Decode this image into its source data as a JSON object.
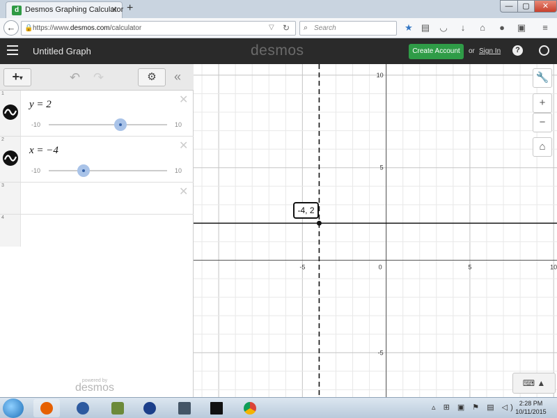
{
  "browser": {
    "tab_title": "Desmos Graphing Calculator",
    "tab_close": "✕",
    "new_tab": "+",
    "url_prefix": "https://www.",
    "url_domain": "desmos.com",
    "url_path": "/calculator",
    "search_placeholder": "Search",
    "window_buttons": {
      "minimize": "—",
      "maximize": "▢",
      "close": "✕"
    }
  },
  "app": {
    "graph_title": "Untitled Graph",
    "logo": "desmos",
    "create_account": "Create Account",
    "or": "or",
    "sign_in": "Sign In",
    "help": "?"
  },
  "expressions": [
    {
      "index": "1",
      "latex": "y = 2",
      "slider_min": "-10",
      "slider_max": "10",
      "slider_value": 2
    },
    {
      "index": "2",
      "latex": "x = −4",
      "slider_min": "-10",
      "slider_max": "10",
      "slider_value": -4
    },
    {
      "index": "3"
    },
    {
      "index": "4"
    }
  ],
  "powered": {
    "by": "powered by",
    "logo": "desmos"
  },
  "graph": {
    "x_range": [
      -11.5,
      10.2
    ],
    "y_range": [
      -7.4,
      10.6
    ],
    "x_tick_labels": [
      "-5",
      "0",
      "5",
      "10"
    ],
    "y_tick_labels": [
      "10",
      "5",
      "-5"
    ],
    "lines": [
      {
        "kind": "horizontal",
        "value": 2,
        "style": "solid",
        "color": "#111111"
      },
      {
        "kind": "vertical",
        "value": -4,
        "style": "dashed",
        "color": "#111111"
      }
    ],
    "point": {
      "x": -4,
      "y": 2,
      "label": "-4, 2"
    }
  },
  "taskbar": {
    "time": "2:28 PM",
    "date": "10/11/2015"
  },
  "colors": {
    "accent_green": "#2f9c47",
    "header_bg": "#2a2a2a",
    "slider_knob": "#a9c3e8"
  }
}
